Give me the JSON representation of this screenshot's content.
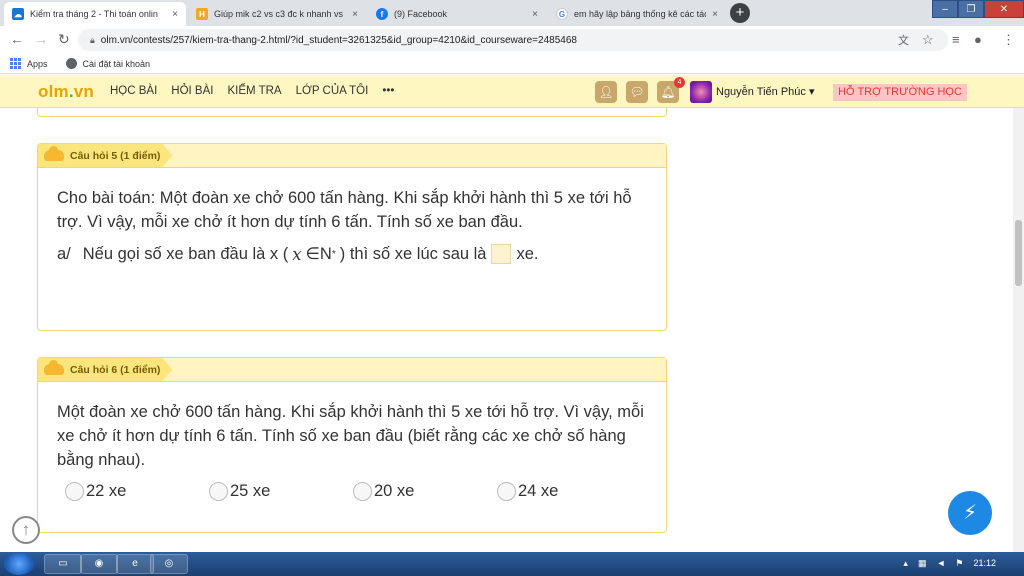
{
  "browser": {
    "tabs": [
      {
        "title": "Kiểm tra tháng 2 - Thi toán onlin",
        "icon": "olm-cloud-icon",
        "active": true
      },
      {
        "title": "Giúp mik c2 vs c3 đc k nhanh vs",
        "icon": "hoc24-icon",
        "active": false
      },
      {
        "title": "(9) Facebook",
        "icon": "facebook-icon",
        "active": false
      },
      {
        "title": "em hãy lập bảng thống kê các tác",
        "icon": "google-icon",
        "active": false
      }
    ],
    "tab_close": "×",
    "new_tab": "+",
    "url": "olm.vn/contests/257/kiem-tra-thang-2.html/?id_student=3261325&id_group=4210&id_courseware=2485468",
    "bookmarks": {
      "apps": "Apps",
      "account": "Cài đặt tài khoản"
    }
  },
  "site": {
    "logo": {
      "main": "olm",
      "dot": ".",
      "tld": "vn"
    },
    "menu": [
      "HỌC BÀI",
      "HỎI BÀI",
      "KIỂM TRA",
      "LỚP CỦA TÔI",
      "•••"
    ],
    "notification_count": "4",
    "user_name": "Nguyễn Tiến Phúc ▾",
    "support": "HỖ TRỢ TRƯỜNG HỌC"
  },
  "questions": [
    {
      "label": "Câu hỏi 5 (1 điểm)",
      "text": "Cho bài toán:  Một đoàn xe chở 600 tấn hàng. Khi sắp khởi hành thì 5 xe tới hỗ trợ. Vì vậy, mỗi xe chở ít hơn dự tính 6 tấn. Tính số xe ban đầu.",
      "part": {
        "prefix": "a/",
        "before": "Nếu gọi số xe ban đầu là x (",
        "math_var": "x",
        "math_set": "∈N",
        "math_sup": "*",
        "after": ") thì số xe lúc sau là",
        "unit": "xe."
      }
    },
    {
      "label": "Câu hỏi 6 (1 điểm)",
      "text": "Một đoàn xe chở 600 tấn hàng. Khi sắp khởi hành thì 5 xe tới hỗ trợ. Vì vậy, mỗi xe chở ít hơn dự tính 6 tấn. Tính số xe ban đầu (biết rằng các xe chở số hàng bằng nhau).",
      "options": [
        "22 xe",
        "25 xe",
        "20 xe",
        "24 xe"
      ]
    }
  ],
  "taskbar": {
    "clock": "21:12"
  }
}
